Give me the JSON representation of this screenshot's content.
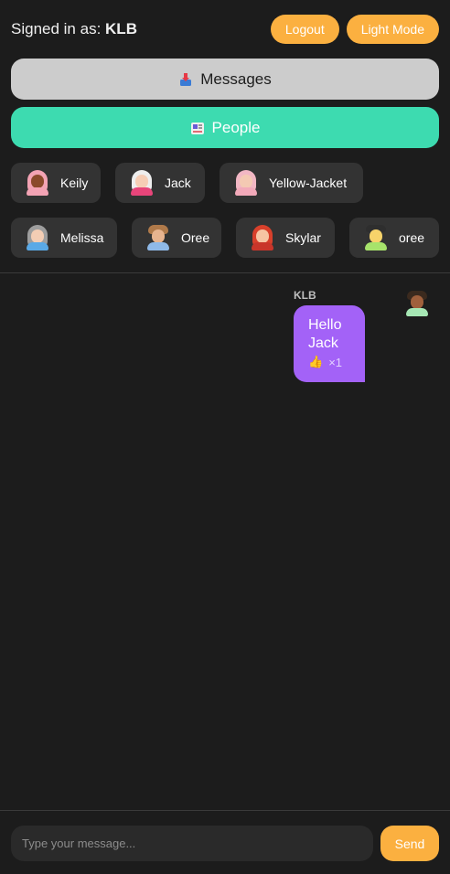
{
  "header": {
    "signed_in_prefix": "Signed in as:",
    "username": "KLB",
    "logout_label": "Logout",
    "theme_label": "Light Mode"
  },
  "nav": {
    "messages_label": "Messages",
    "messages_icon": "inbox-tray-icon",
    "people_label": "People",
    "people_icon": "contact-card-icon"
  },
  "people": [
    {
      "name": "Keily",
      "icon": "woman-hijab-avatar"
    },
    {
      "name": "Jack",
      "icon": "white-haired-avatar"
    },
    {
      "name": "Yellow-Jacket",
      "icon": "woman-pink-hair-avatar"
    },
    {
      "name": "Melissa",
      "icon": "elderly-woman-avatar"
    },
    {
      "name": "Oree",
      "icon": "man-beard-avatar"
    },
    {
      "name": "Skylar",
      "icon": "red-haired-woman-avatar"
    },
    {
      "name": "oree",
      "icon": "man-green-shirt-avatar"
    }
  ],
  "messages": [
    {
      "author": "KLB",
      "text": "Hello Jack",
      "reaction": "👍",
      "reaction_count": "×1"
    }
  ],
  "composer": {
    "placeholder": "Type your message...",
    "send_label": "Send"
  },
  "colors": {
    "background": "#1c1c1c",
    "accent_orange": "#fbb040",
    "people_green": "#3ddbb0",
    "messages_gray": "#cccccc",
    "bubble_purple": "#a362f7",
    "chip_bg": "#333333"
  }
}
